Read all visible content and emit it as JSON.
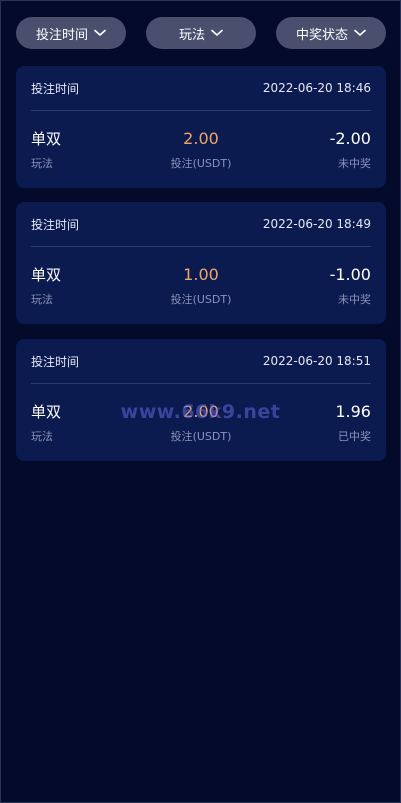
{
  "filters": [
    {
      "label": "投注时间",
      "icon": "chevron-down-icon"
    },
    {
      "label": "玩法",
      "icon": "chevron-down-icon"
    },
    {
      "label": "中奖状态",
      "icon": "chevron-down-icon"
    }
  ],
  "records": [
    {
      "time_label": "投注时间",
      "time": "2022-06-20 18:46",
      "play": "单双",
      "play_label": "玩法",
      "bet": "2.00",
      "bet_label": "投注(USDT)",
      "result": "-2.00",
      "status": "未中奖"
    },
    {
      "time_label": "投注时间",
      "time": "2022-06-20 18:49",
      "play": "单双",
      "play_label": "玩法",
      "bet": "1.00",
      "bet_label": "投注(USDT)",
      "result": "-1.00",
      "status": "未中奖"
    },
    {
      "time_label": "投注时间",
      "time": "2022-06-20 18:51",
      "play": "单双",
      "play_label": "玩法",
      "bet": "2.00",
      "bet_label": "投注(USDT)",
      "result": "1.96",
      "status": "已中奖"
    }
  ],
  "watermark": "www.66k9.net",
  "colors": {
    "background": "#030a2a",
    "card": "#0b1a4f",
    "filter_button": "#4a4f6d",
    "bet_amount": "#f0a66a",
    "muted_text": "#8a93b8"
  }
}
